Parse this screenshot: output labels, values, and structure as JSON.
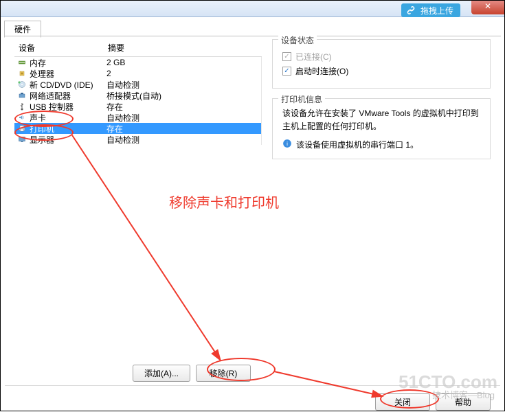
{
  "titlebar": {
    "upload_label": "拖拽上传",
    "close_label": "✕"
  },
  "tab": {
    "hardware": "硬件"
  },
  "list": {
    "head_device": "设备",
    "head_summary": "摘要",
    "rows": [
      {
        "icon": "memory-icon",
        "name": "内存",
        "summary": "2 GB"
      },
      {
        "icon": "cpu-icon",
        "name": "处理器",
        "summary": "2"
      },
      {
        "icon": "cddvd-icon",
        "name": "新 CD/DVD (IDE)",
        "summary": "自动检测"
      },
      {
        "icon": "network-icon",
        "name": "网络适配器",
        "summary": "桥接模式(自动)"
      },
      {
        "icon": "usb-icon",
        "name": "USB 控制器",
        "summary": "存在"
      },
      {
        "icon": "sound-icon",
        "name": "声卡",
        "summary": "自动检测"
      },
      {
        "icon": "printer-icon",
        "name": "打印机",
        "summary": "存在"
      },
      {
        "icon": "display-icon",
        "name": "显示器",
        "summary": "自动检测"
      }
    ],
    "selected_index": 6
  },
  "status_group": {
    "legend": "设备状态",
    "chk_connected": "已连接(C)",
    "chk_connect_on_power": "启动时连接(O)"
  },
  "printer_group": {
    "legend": "打印机信息",
    "body": "该设备允许在安装了 VMware Tools 的虚拟机中打印到主机上配置的任何打印机。",
    "info": "该设备使用虚拟机的串行端口 1。"
  },
  "buttons": {
    "add": "添加(A)...",
    "remove": "移除(R)",
    "close": "关闭",
    "help": "帮助"
  },
  "annotation": {
    "text": "移除声卡和打印机"
  },
  "watermark": {
    "big": "51CTO.com",
    "small": "技术博客—Blog"
  }
}
